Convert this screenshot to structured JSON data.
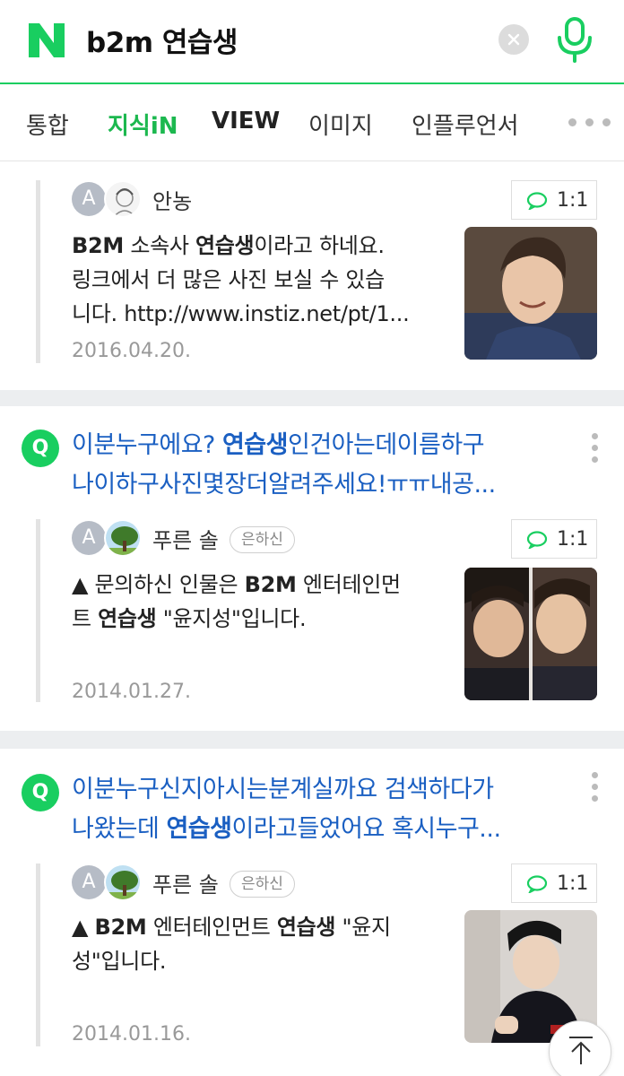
{
  "header": {
    "logo_letter": "N",
    "query": "b2m 연습생",
    "brand_color": "#19CE60"
  },
  "tabs": [
    {
      "label": "통합"
    },
    {
      "label": "지식iN",
      "active": true
    },
    {
      "label": "VIEW"
    },
    {
      "label": "이미지"
    },
    {
      "label": "인플루언서"
    }
  ],
  "results": [
    {
      "question": null,
      "answerer": "안농",
      "rank": null,
      "chat_label": "1:1",
      "avatar_letter": "A",
      "answer_lines": [
        [
          {
            "t": "B2M",
            "b": true
          },
          {
            "t": " 소속사 "
          },
          {
            "t": "연습생",
            "b": true
          },
          {
            "t": "이라고 하네요."
          }
        ],
        [
          {
            "t": "링크에서 더 많은 사진 보실 수 있습"
          }
        ],
        [
          {
            "t": "니다. http://www.instiz.net/pt/1..."
          }
        ]
      ],
      "date": "2016.04.20."
    },
    {
      "question_badge": "Q",
      "question_lines": [
        [
          {
            "t": "이분누구에요? "
          },
          {
            "t": "연습생",
            "b": true
          },
          {
            "t": "인건아는데이름하구"
          }
        ],
        [
          {
            "t": "나이하구사진몇장더알려주세요!ㅠㅠ내공..."
          }
        ]
      ],
      "answerer": "푸른 솔",
      "rank": "은하신",
      "chat_label": "1:1",
      "avatar_letter": "A",
      "answer_lines": [
        [
          {
            "t": "▲ 문의하신 인물은 "
          },
          {
            "t": "B2M",
            "b": true
          },
          {
            "t": " 엔터테인먼"
          }
        ],
        [
          {
            "t": "트 "
          },
          {
            "t": "연습생",
            "b": true
          },
          {
            "t": " \"윤지성\"입니다."
          }
        ]
      ],
      "date": "2014.01.27."
    },
    {
      "question_badge": "Q",
      "question_lines": [
        [
          {
            "t": "이분누구신지아시는분계실까요 검색하다가"
          }
        ],
        [
          {
            "t": "나왔는데 "
          },
          {
            "t": "연습생",
            "b": true
          },
          {
            "t": "이라고들었어요 혹시누구..."
          }
        ]
      ],
      "answerer": "푸른 솔",
      "rank": "은하신",
      "chat_label": "1:1",
      "avatar_letter": "A",
      "answer_lines": [
        [
          {
            "t": "▲ "
          },
          {
            "t": "B2M",
            "b": true
          },
          {
            "t": " 엔터테인먼트 "
          },
          {
            "t": "연습생",
            "b": true
          },
          {
            "t": " \"윤지"
          }
        ],
        [
          {
            "t": "성\"입니다."
          }
        ]
      ],
      "date": "2014.01.16."
    }
  ]
}
